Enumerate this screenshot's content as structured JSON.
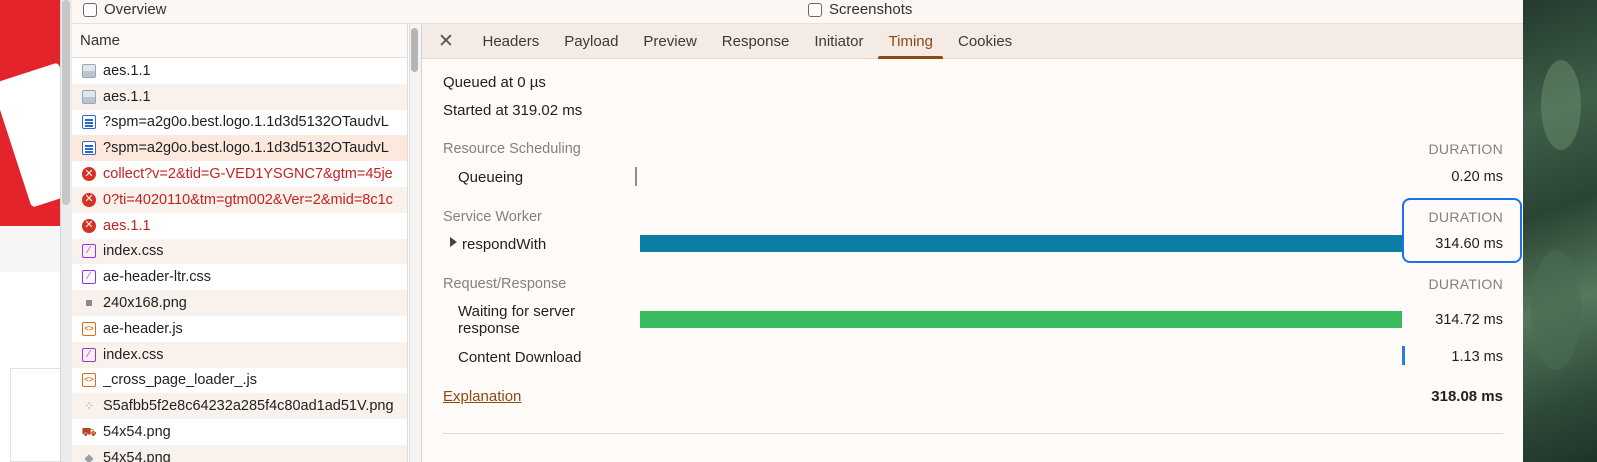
{
  "toolbar": {
    "overview_label": "Overview",
    "screenshots_label": "Screenshots"
  },
  "request_list": {
    "header": "Name",
    "rows": [
      {
        "label": "aes.1.1",
        "icon": "image-icon",
        "state": "normal"
      },
      {
        "label": "aes.1.1",
        "icon": "image-icon",
        "state": "normal"
      },
      {
        "label": "?spm=a2g0o.best.logo.1.1d3d5132OTaudvL",
        "icon": "document-icon",
        "state": "normal"
      },
      {
        "label": "?spm=a2g0o.best.logo.1.1d3d5132OTaudvL",
        "icon": "document-icon",
        "state": "selected"
      },
      {
        "label": "collect?v=2&tid=G-VED1YSGNC7&gtm=45je",
        "icon": "error-icon",
        "state": "error"
      },
      {
        "label": "0?ti=4020110&tm=gtm002&Ver=2&mid=8c1c",
        "icon": "error-icon",
        "state": "error"
      },
      {
        "label": "aes.1.1",
        "icon": "error-icon",
        "state": "error"
      },
      {
        "label": "index.css",
        "icon": "stylesheet-icon",
        "state": "normal"
      },
      {
        "label": "ae-header-ltr.css",
        "icon": "stylesheet-icon",
        "state": "normal"
      },
      {
        "label": "240x168.png",
        "icon": "image-small-icon",
        "state": "normal"
      },
      {
        "label": "ae-header.js",
        "icon": "script-icon",
        "state": "normal"
      },
      {
        "label": "index.css",
        "icon": "stylesheet-icon",
        "state": "normal"
      },
      {
        "label": "_cross_page_loader_.js",
        "icon": "script-icon",
        "state": "normal"
      },
      {
        "label": "S5afbb5f2e8c64232a285f4c80ad1ad51V.png",
        "icon": "font-icon",
        "state": "normal"
      },
      {
        "label": "54x54.png",
        "icon": "truck-image-icon",
        "state": "normal"
      },
      {
        "label": "54x54.png",
        "icon": "font-icon",
        "state": "normal"
      }
    ]
  },
  "detail": {
    "close_label": "✕",
    "tabs": [
      "Headers",
      "Payload",
      "Preview",
      "Response",
      "Initiator",
      "Timing",
      "Cookies"
    ],
    "active_tab": "Timing",
    "queued_at": "Queued at 0 µs",
    "started_at": "Started at 319.02 ms",
    "duration_label": "DURATION",
    "sections": {
      "resource_scheduling": {
        "title": "Resource Scheduling",
        "queueing_label": "Queueing",
        "queueing_value": "0.20 ms"
      },
      "service_worker": {
        "title": "Service Worker",
        "respond_label": "respondWith",
        "respond_value": "314.60 ms"
      },
      "request_response": {
        "title": "Request/Response",
        "waiting_label_line1": "Waiting for server",
        "waiting_label_line2": "response",
        "waiting_value": "314.72 ms",
        "download_label": "Content Download",
        "download_value": "1.13 ms"
      }
    },
    "explanation_label": "Explanation",
    "total": "318.08 ms",
    "colors": {
      "service_worker_bar": "#0b7fa3",
      "waiting_bar": "#3bbb5f",
      "download_bar": "#2b7be4",
      "accent": "#8a4a12",
      "focus_outline": "#1a73e8"
    }
  }
}
